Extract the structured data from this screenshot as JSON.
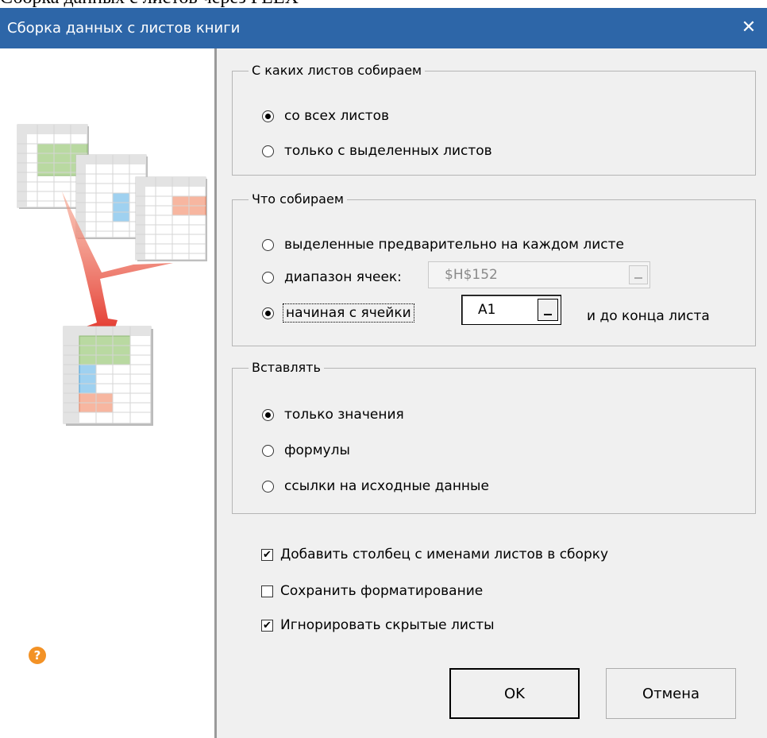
{
  "caption": "Сборка данных с листов через PLEX",
  "window": {
    "title": "Сборка данных с листов книги",
    "close_symbol": "✕"
  },
  "help": {
    "symbol": "?",
    "color": "#f39226"
  },
  "groups": {
    "sheets": {
      "title": "С каких листов собираем",
      "options": [
        {
          "label": "со всех листов",
          "selected": true
        },
        {
          "label": "только с выделенных листов",
          "selected": false
        }
      ]
    },
    "what": {
      "title": "Что собираем",
      "option_preselected": "выделенные предварительно на каждом листе",
      "option_range": "диапазон ячеек:",
      "range_value": "$H$152",
      "option_from_cell": "начиная с ячейки",
      "from_cell_value": "A1",
      "to_end": "и до конца листа",
      "selected": "from_cell"
    },
    "paste": {
      "title": "Вставлять",
      "options": [
        {
          "label": "только значения",
          "selected": true
        },
        {
          "label": "формулы",
          "selected": false
        },
        {
          "label": "ссылки на исходные данные",
          "selected": false
        }
      ]
    }
  },
  "checkboxes": [
    {
      "label": "Добавить столбец с именами листов в сборку",
      "checked": true
    },
    {
      "label": "Сохранить форматирование",
      "checked": false
    },
    {
      "label": "Игнорировать скрытые листы",
      "checked": true
    }
  ],
  "buttons": {
    "ok": "OK",
    "cancel": "Отмена"
  },
  "colors": {
    "titlebar": "#2d66a8",
    "green": "#b9d9a1",
    "blue": "#9fd1f0",
    "orange": "#f7b6a0",
    "arrow": "#e8321c"
  }
}
